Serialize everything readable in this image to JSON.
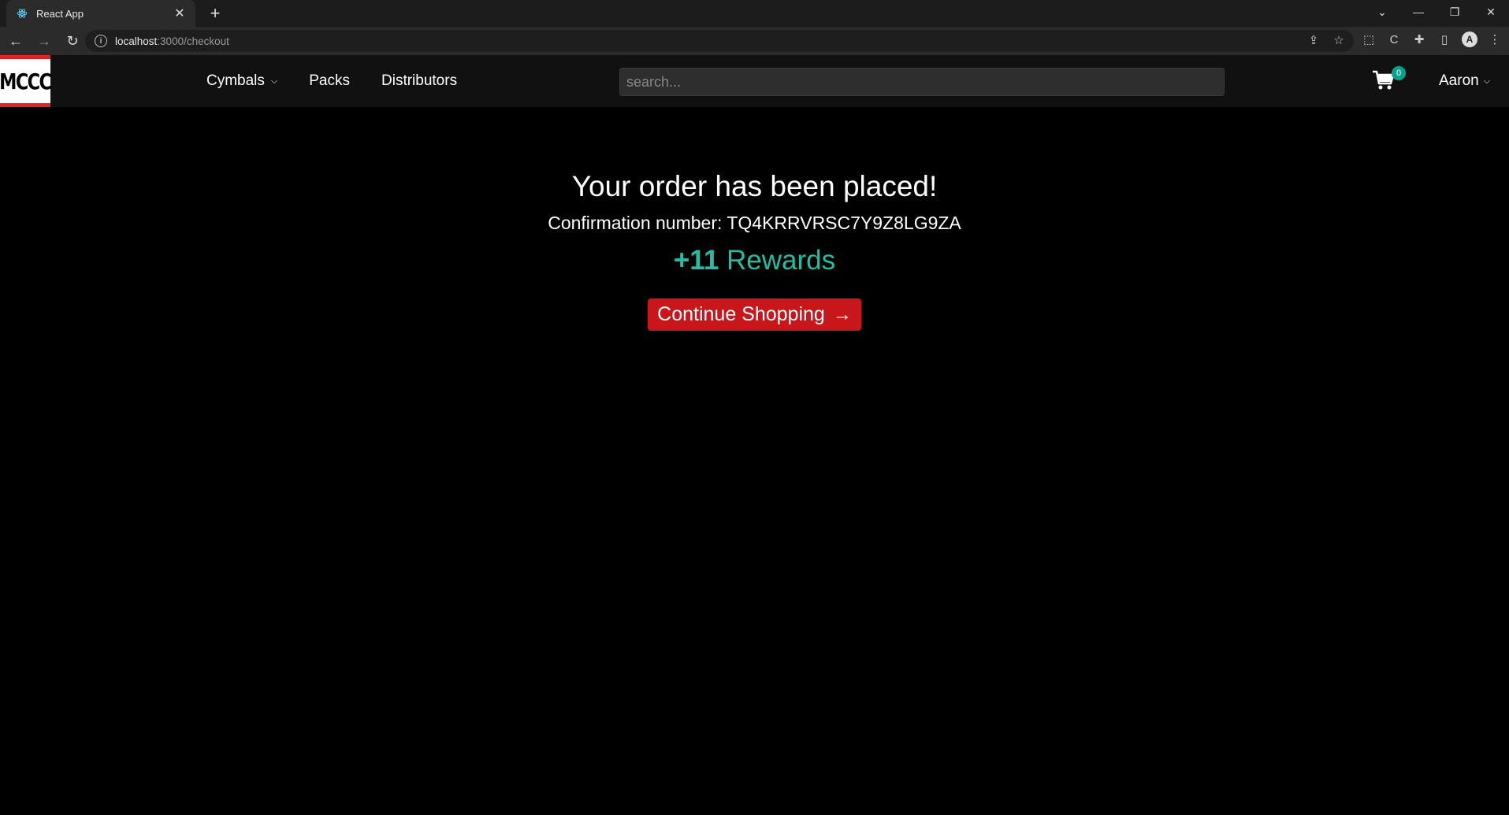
{
  "browser": {
    "tab_title": "React App",
    "url_host": "localhost",
    "url_path": ":3000/checkout",
    "icons": [
      "react-icon",
      "close-icon",
      "plus-icon",
      "back-icon",
      "forward-icon",
      "reload-icon",
      "info-icon",
      "share-icon",
      "star-icon",
      "extension-icon",
      "puzzle-icon",
      "sidepanel-icon",
      "menu-icon"
    ]
  },
  "header": {
    "logo_text": "MCCC",
    "nav": [
      {
        "label": "Cymbals",
        "dropdown": true
      },
      {
        "label": "Packs"
      },
      {
        "label": "Distributors"
      }
    ],
    "search_placeholder": "search...",
    "cart_count": "0",
    "user_name": "Aaron"
  },
  "main": {
    "headline": "Your order has been placed!",
    "confirmation_label": "Confirmation number:",
    "confirmation_number": "TQ4KRRVRSC7Y9Z8LG9ZA",
    "rewards_points": "+11",
    "rewards_label": "Rewards",
    "continue_label": "Continue Shopping"
  },
  "colors": {
    "accent_red": "#c8161b",
    "rewards_teal": "#1fbfa6",
    "badge_teal": "#0aa08a"
  }
}
